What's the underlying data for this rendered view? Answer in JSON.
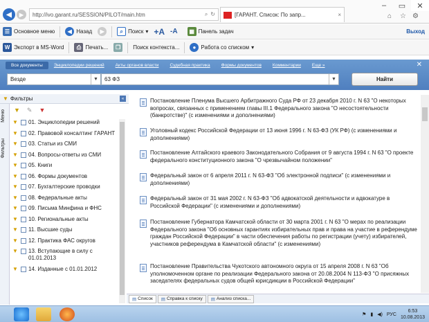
{
  "browser": {
    "url": "http://ivo.garant.ru/SESSION/PILOT/main.htm",
    "tab_title": "[ГАРАНТ. Список: По запр...",
    "tab_close": "×",
    "win_min": "–",
    "win_max": "▭",
    "win_close": "✕"
  },
  "toolbar1": {
    "main_menu": "Основное меню",
    "back": "Назад",
    "search": "Поиск",
    "taskbar_panel": "Панель задач",
    "exit": "Выход"
  },
  "toolbar2": {
    "export_word": "Экспорт в MS-Word",
    "print": "Печать...",
    "context_search": "Поиск контекста...",
    "list_work": "Работа со списком"
  },
  "search": {
    "tabs": [
      "Все документы",
      "Энциклопедии решений",
      "Акты органов власти",
      "Судебная практика",
      "Формы документов",
      "Комментарии",
      "Еще"
    ],
    "scope": "Везде",
    "query": "63 ФЗ",
    "find_button": "Найти"
  },
  "left": {
    "title": "Фильтры",
    "vtab_menu": "Меню",
    "vtab_filters": "Фильтры",
    "filters": [
      "01. Энциклопедии решений",
      "02. Правовой консалтинг ГАРАНТ",
      "03. Статьи из СМИ",
      "04. Вопросы-ответы из СМИ",
      "05. Книги",
      "06. Формы документов",
      "07. Бухгалтерские проводки",
      "08. Федеральные акты",
      "09. Письма Минфина и ФНС",
      "10. Региональные акты",
      "11. Высшие суды",
      "12. Практика ФАС округов",
      "13. Вступающие в силу с 01.01.2013",
      "14. Изданные с 01.01.2012"
    ]
  },
  "documents": [
    "Постановление Пленума Высшего Арбитражного Суда РФ от 23 декабря 2010 г. N 63 \"О некоторых вопросах, связанных с применением главы III.1 Федерального закона \"О несостоятельности (банкротстве)\" (с изменениями и дополнениями)",
    "Уголовный кодекс Российской Федерации от 13 июня 1996 г. N 63-ФЗ (УК РФ) (с изменениями и дополнениями)",
    "Постановление Алтайского краевого Законодательного Собрания от 9 августа 1994 г. N 63 \"О проекте федерального конституционного закона \"О чрезвычайном положении\"",
    "Федеральный закон от 6 апреля 2011 г. N 63-ФЗ \"Об электронной подписи\" (с изменениями и дополнениями)",
    "Федеральный закон от 31 мая 2002 г. N 63-ФЗ \"Об адвокатской деятельности и адвокатуре в Российской Федерации\" (с изменениями и дополнениями)",
    "Постановление Губернатора Камчатской области от 30 марта 2001 г. N 63 \"О мерах по реализации Федерального закона \"Об основных гарантиях избирательных прав и права на участие в референдуме граждан Российской Федерации\" в части обеспечения работы по регистрации (учету) избирателей, участников референдума в Камчатской области\" (с изменениями)",
    "Постановление Правительства Чукотского автономного округа от 15 апреля 2008 г. N 63 \"Об уполномоченном органе по реализации Федерального закона от 20.08.2004 N 113-ФЗ \"О присяжных заседателях федеральных судов общей юрисдикции в Российской Федерации\""
  ],
  "bottom_tabs": [
    "Список",
    "Справка к списку",
    "Анализ списка..."
  ],
  "taskbar": {
    "lang": "РУС",
    "time": "6:53",
    "date": "10.08.2013"
  }
}
